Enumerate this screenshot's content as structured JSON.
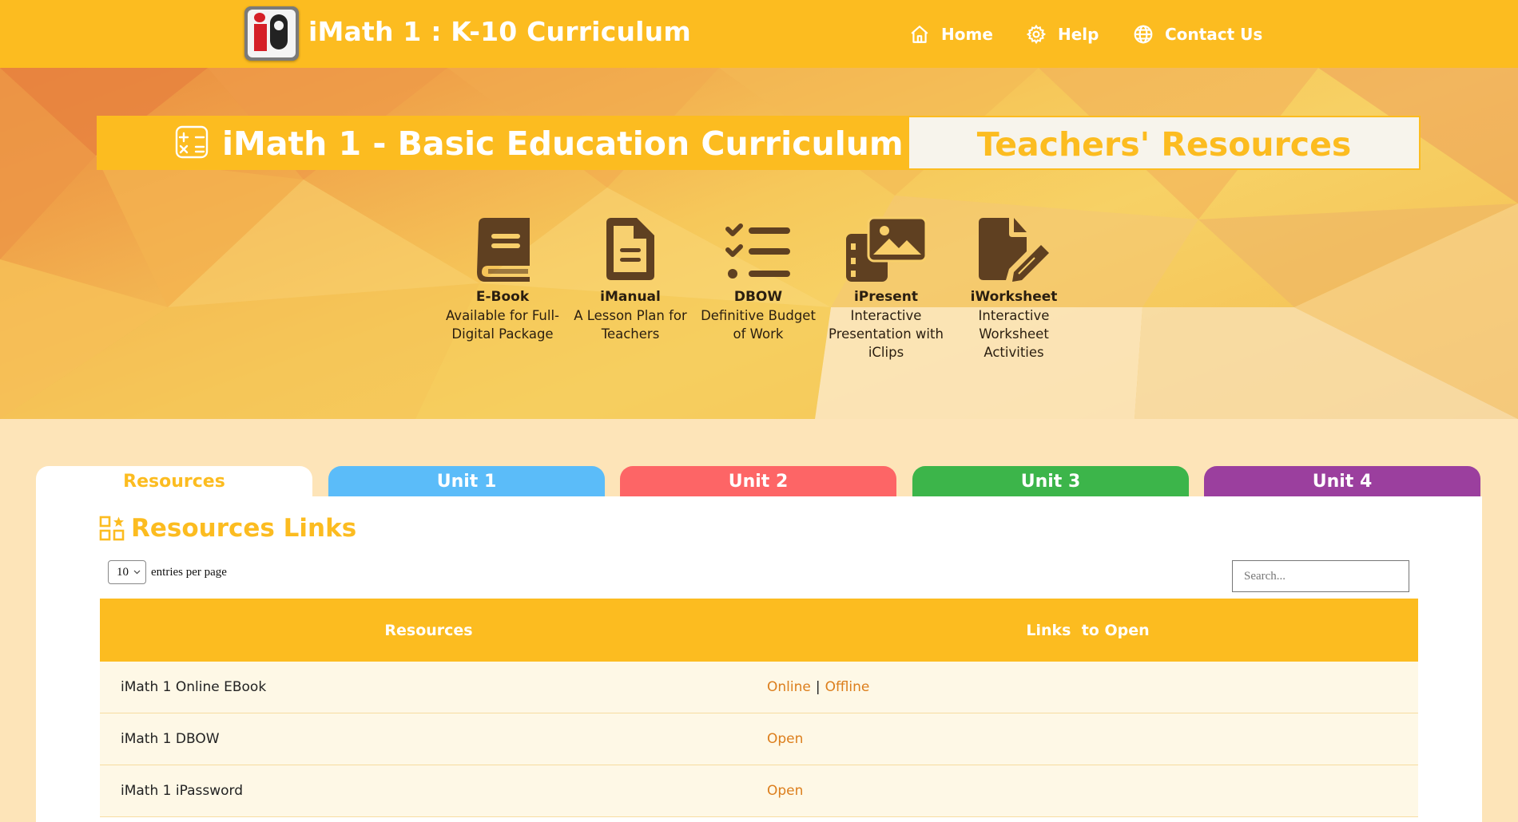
{
  "header": {
    "title": "iMath 1 : K-10 Curriculum",
    "nav": [
      {
        "label": "Home",
        "icon": "home-icon"
      },
      {
        "label": "Help",
        "icon": "gear-icon"
      },
      {
        "label": "Contact Us",
        "icon": "globe-icon"
      }
    ]
  },
  "banner": {
    "left_title": "iMath 1 - Basic Education Curriculum",
    "right_title": "Teachers' Resources"
  },
  "features": [
    {
      "name": "E-Book",
      "desc": "Available for Full-Digital Package",
      "icon": "book-icon"
    },
    {
      "name": "iManual",
      "desc": "A Lesson Plan for Teachers",
      "icon": "document-icon"
    },
    {
      "name": "DBOW",
      "desc": "Definitive Budget of Work",
      "icon": "checklist-icon"
    },
    {
      "name": "iPresent",
      "desc": "Interactive Presentation with iClips",
      "icon": "gallery-icon"
    },
    {
      "name": "iWorksheet",
      "desc": "Interactive Worksheet Activities",
      "icon": "file-edit-icon"
    }
  ],
  "tabs": [
    {
      "label": "Resources",
      "active": true
    },
    {
      "label": "Unit 1"
    },
    {
      "label": "Unit 2"
    },
    {
      "label": "Unit 3"
    },
    {
      "label": "Unit 4"
    }
  ],
  "panel": {
    "title": "Resources Links",
    "entries_value": "10",
    "entries_label": "entries per page",
    "search_placeholder": "Search...",
    "table": {
      "headers": [
        "Resources",
        "Links  to Open"
      ],
      "rows": [
        {
          "resource": "iMath 1 Online EBook",
          "links": [
            "Online",
            "Offline"
          ]
        },
        {
          "resource": "iMath 1 DBOW",
          "links": [
            "Open"
          ]
        },
        {
          "resource": "iMath 1 iPassword",
          "links": [
            "Open"
          ]
        }
      ]
    }
  },
  "colors": {
    "brand": "#fcbc20",
    "unit1": "#5bbcf9",
    "unit2": "#fd6566",
    "unit3": "#3cb54a",
    "unit4": "#9b3f9e",
    "icon_brown": "#5f4021",
    "link": "#dc7e1c"
  }
}
